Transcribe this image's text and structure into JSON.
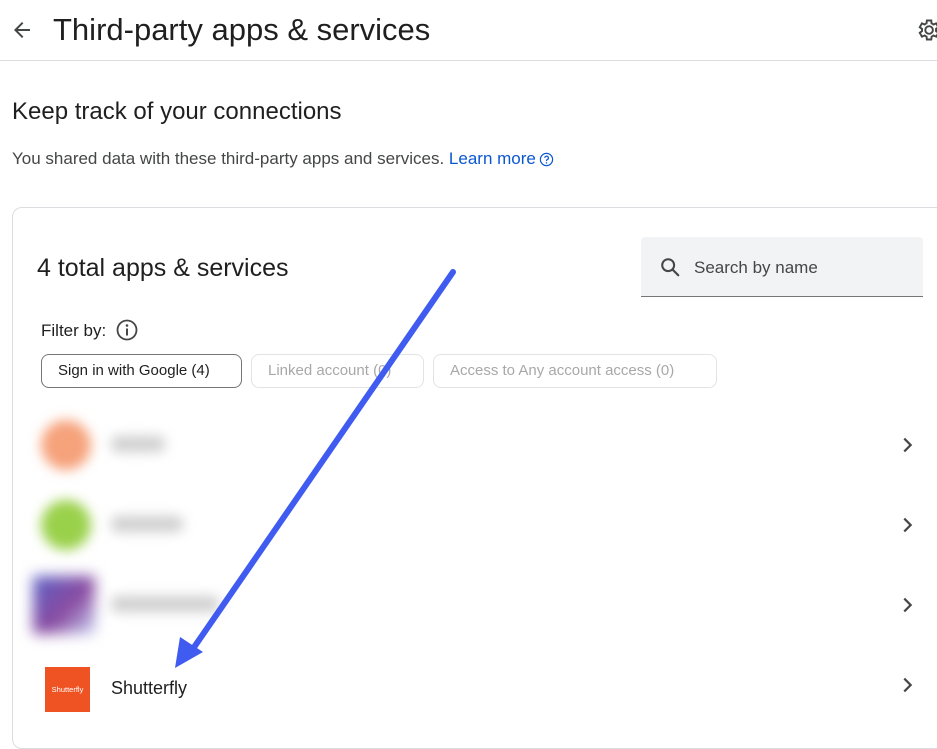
{
  "header": {
    "title": "Third-party apps & services",
    "back_icon": "arrow-left-icon",
    "settings_icon": "gear-icon"
  },
  "intro": {
    "heading": "Keep track of your connections",
    "text": "You shared data with these third-party apps and services.",
    "learn_more": "Learn more"
  },
  "panel": {
    "count_text": "4 total apps & services",
    "search_placeholder": "Search by name",
    "filter_label": "Filter by:",
    "chips": [
      {
        "label": "Sign in with Google (4)",
        "selected": true
      },
      {
        "label": "Linked account (0)",
        "selected": false
      },
      {
        "label": "Access to Any account access (0)",
        "selected": false
      }
    ]
  },
  "apps": [
    {
      "name": "",
      "blurred": true,
      "logo_color": "#f6a27b"
    },
    {
      "name": "",
      "blurred": true,
      "logo_color": "#9ad14b"
    },
    {
      "name": "",
      "blurred": true,
      "logo_color": "#6a5cc2"
    },
    {
      "name": "Shutterfly",
      "blurred": false,
      "logo_text": "Shutterfly",
      "logo_color": "#f05323"
    }
  ],
  "annotation": {
    "arrow_color": "#3f5bf0"
  },
  "colors": {
    "link": "#0b57d0",
    "border": "#dadce0"
  }
}
